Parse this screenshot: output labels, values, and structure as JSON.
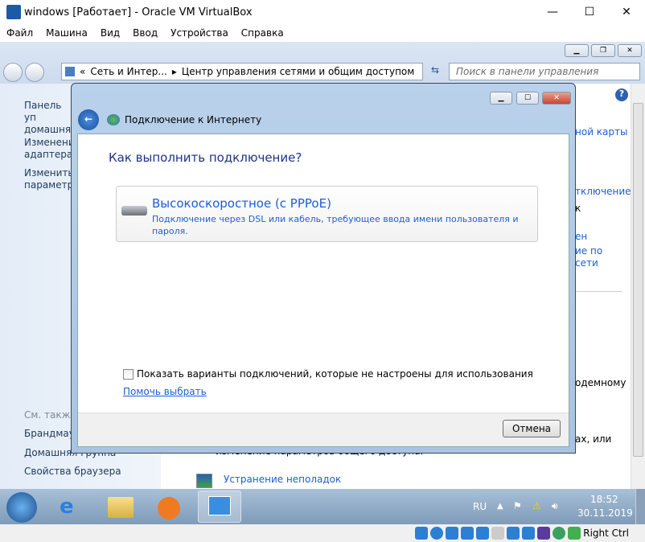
{
  "vbox": {
    "title": "windows [Работает] - Oracle VM VirtualBox",
    "menu": [
      "Файл",
      "Машина",
      "Вид",
      "Ввод",
      "Устройства",
      "Справка"
    ],
    "status_key": "Right Ctrl"
  },
  "explorer": {
    "breadcrumb_root": "«",
    "crumb1": "Сеть и Интер...",
    "crumb2": "Центр управления сетями и общим доступом",
    "search_placeholder": "Поиск в панели управления",
    "left": {
      "items": [
        "Панель уп\nдомашняя",
        "Изменени\nадаптера",
        "Изменить\nпараметры"
      ],
      "see_also": "См. также",
      "links": [
        "Брандмауэ",
        "Домашняя группа",
        "Свойства браузера"
      ]
    },
    "right": {
      "frag1": "ной карты",
      "frag2": "тключение",
      "frag3": "к",
      "frag4": "ен",
      "frag5": "ие по",
      "frag6": "сети",
      "frag7": "одемному",
      "frag8": "ах, или",
      "text1": "изменение параметров общего доступа.",
      "troubleshoot": "Устранение неполадок"
    }
  },
  "dialog": {
    "title": "Подключение к Интернету",
    "question": "Как выполнить подключение?",
    "option_title": "Высокоскоростное (с PPPoE)",
    "option_desc": "Подключение через DSL или кабель, требующее ввода имени пользователя и пароля.",
    "checkbox_label": "Показать варианты подключений, которые не настроены для использования",
    "checkbox_checked": false,
    "help_link": "Помочь выбрать",
    "cancel": "Отмена"
  },
  "taskbar": {
    "lang": "RU",
    "time": "18:52",
    "date": "30.11.2019"
  }
}
